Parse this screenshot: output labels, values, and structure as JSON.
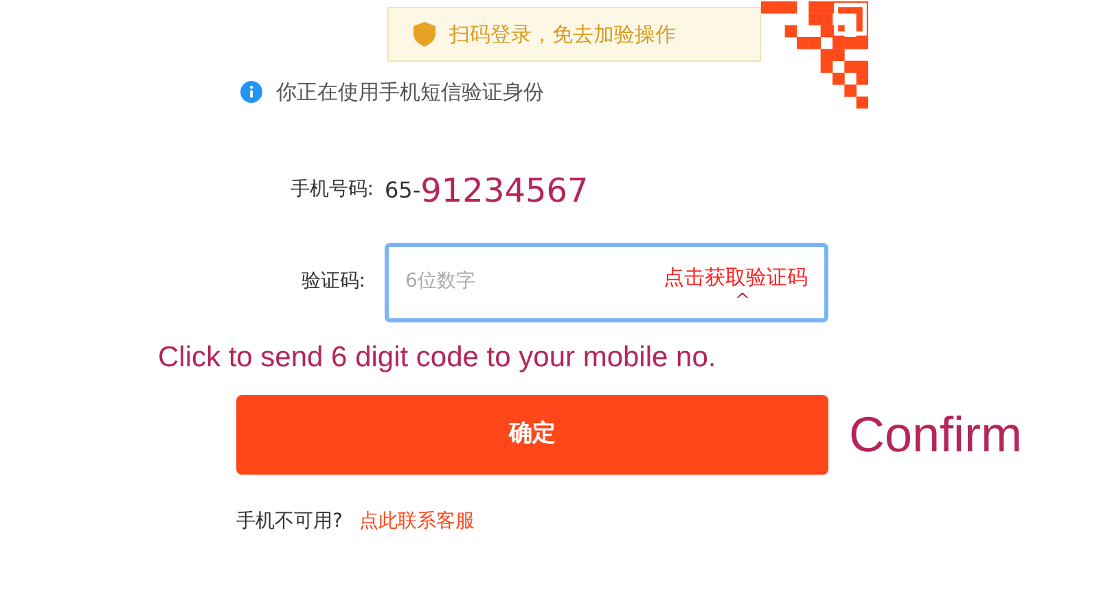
{
  "tooltip": {
    "text": "扫码登录，免去加验操作"
  },
  "notice": "你正在使用手机短信验证身份",
  "phone": {
    "label": "手机号码:",
    "prefix": "65-",
    "number": "91234567"
  },
  "code": {
    "label": "验证码:",
    "placeholder": "6位数字",
    "link": "点击获取验证码",
    "pointer": "^"
  },
  "annotation": "Click to send 6 digit code to your mobile no.",
  "confirm": {
    "label": "确定",
    "translation": "Confirm"
  },
  "footer": {
    "text": "手机不可用?",
    "link": "点此联系客服"
  }
}
